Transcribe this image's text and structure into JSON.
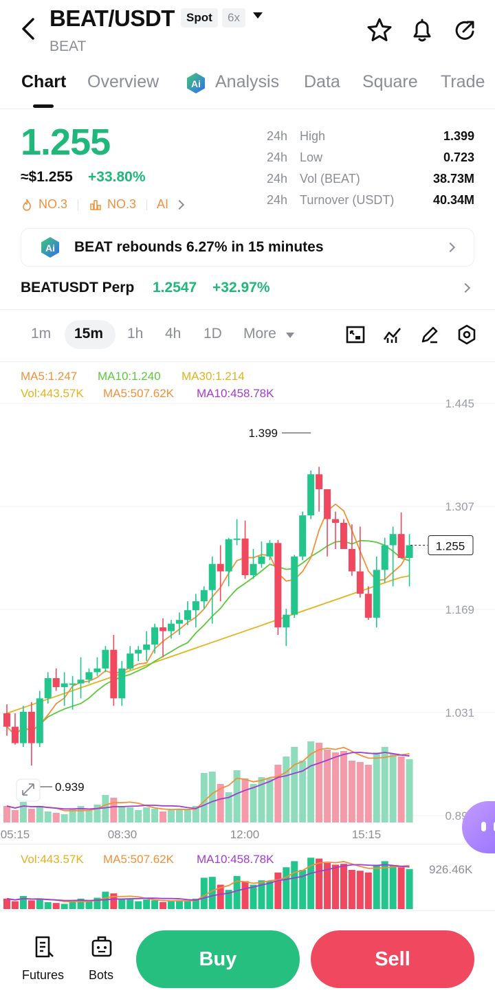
{
  "header": {
    "pair": "BEAT/USDT",
    "market_badge": "Spot",
    "leverage_badge": "6x",
    "subtitle": "BEAT"
  },
  "tabs": [
    {
      "label": "Chart",
      "active": true
    },
    {
      "label": "Overview"
    },
    {
      "label": "Analysis"
    },
    {
      "label": "Data"
    },
    {
      "label": "Square"
    },
    {
      "label": "Trade"
    }
  ],
  "ticker": {
    "last_price": "1.255",
    "usd_price": "≈$1.255",
    "change_pct": "+33.80%",
    "rank_hot": "NO.3",
    "rank_gain": "NO.3",
    "ai_label": "AI",
    "stats": [
      {
        "period": "24h",
        "label": "High",
        "value": "1.399"
      },
      {
        "period": "24h",
        "label": "Low",
        "value": "0.723"
      },
      {
        "period": "24h",
        "label": "Vol (BEAT)",
        "value": "38.73M"
      },
      {
        "period": "24h",
        "label": "Turnover (USDT)",
        "value": "40.34M"
      }
    ]
  },
  "banner": {
    "text": "BEAT rebounds 6.27% in 15 minutes"
  },
  "perp": {
    "name": "BEATUSDT Perp",
    "price": "1.2547",
    "change": "+32.97%"
  },
  "intervals": {
    "items": [
      "1m",
      "15m",
      "1h",
      "4h",
      "1D"
    ],
    "active": "15m",
    "more_label": "More"
  },
  "legend": {
    "ma5": "MA5:1.247",
    "ma10": "MA10:1.240",
    "ma30": "MA30:1.214",
    "vol": "Vol:443.57K",
    "vol_ma5": "MA5:507.62K",
    "vol_ma10": "MA10:458.78K"
  },
  "sub_legend": {
    "vol": "Vol:443.57K",
    "vol_ma5": "MA5:507.62K",
    "vol_ma10": "MA10:458.78K",
    "max": "926.46K"
  },
  "colors": {
    "up": "#1fb77a",
    "down": "#f0495f",
    "ma5": "#f0913a",
    "ma10": "#5ac93a",
    "ma30": "#e3b21d",
    "vol_ma10": "#a23bd1"
  },
  "chart_data": {
    "type": "candlestick",
    "interval": "15m",
    "y_ticks": [
      "1.445",
      "1.307",
      "1.169",
      "1.031",
      "0.893"
    ],
    "ylim": [
      0.893,
      1.445
    ],
    "x_ticks": [
      "05:15",
      "08:30",
      "12:00",
      "15:15"
    ],
    "high_marker": "1.399",
    "low_marker": "0.939",
    "last_price_label": "1.255",
    "candles": [
      [
        1.03,
        1.042,
        1.0,
        1.012
      ],
      [
        1.012,
        1.03,
        0.988,
        0.99
      ],
      [
        0.99,
        1.04,
        0.985,
        1.032
      ],
      [
        1.032,
        1.045,
        0.96,
        0.99
      ],
      [
        0.99,
        1.06,
        0.985,
        1.05
      ],
      [
        1.05,
        1.085,
        1.043,
        1.077
      ],
      [
        1.077,
        1.09,
        1.06,
        1.065
      ],
      [
        1.065,
        1.085,
        1.04,
        1.07
      ],
      [
        1.07,
        1.08,
        1.035,
        1.07
      ],
      [
        1.07,
        1.105,
        1.05,
        1.075
      ],
      [
        1.075,
        1.09,
        1.07,
        1.085
      ],
      [
        1.085,
        1.105,
        1.08,
        1.09
      ],
      [
        1.09,
        1.12,
        1.085,
        1.115
      ],
      [
        1.115,
        1.135,
        1.04,
        1.05
      ],
      [
        1.05,
        1.1,
        1.04,
        1.09
      ],
      [
        1.09,
        1.12,
        1.088,
        1.11
      ],
      [
        1.11,
        1.12,
        1.1,
        1.115
      ],
      [
        1.115,
        1.14,
        1.1,
        1.122
      ],
      [
        1.122,
        1.15,
        1.11,
        1.145
      ],
      [
        1.145,
        1.157,
        1.105,
        1.14
      ],
      [
        1.14,
        1.155,
        1.13,
        1.15
      ],
      [
        1.15,
        1.165,
        1.135,
        1.155
      ],
      [
        1.155,
        1.18,
        1.148,
        1.168
      ],
      [
        1.168,
        1.19,
        1.145,
        1.18
      ],
      [
        1.18,
        1.2,
        1.17,
        1.195
      ],
      [
        1.195,
        1.24,
        1.15,
        1.23
      ],
      [
        1.23,
        1.255,
        1.18,
        1.22
      ],
      [
        1.22,
        1.265,
        1.2,
        1.263
      ],
      [
        1.263,
        1.29,
        1.255,
        1.264
      ],
      [
        1.264,
        1.288,
        1.21,
        1.215
      ],
      [
        1.215,
        1.25,
        1.21,
        1.23
      ],
      [
        1.23,
        1.26,
        1.225,
        1.24
      ],
      [
        1.24,
        1.262,
        1.235,
        1.258
      ],
      [
        1.258,
        1.262,
        1.135,
        1.145
      ],
      [
        1.145,
        1.17,
        1.12,
        1.162
      ],
      [
        1.162,
        1.242,
        1.158,
        1.24
      ],
      [
        1.24,
        1.3,
        1.235,
        1.295
      ],
      [
        1.295,
        1.355,
        1.29,
        1.35
      ],
      [
        1.35,
        1.36,
        1.3,
        1.33
      ],
      [
        1.33,
        1.33,
        1.24,
        1.29
      ],
      [
        1.29,
        1.3,
        1.25,
        1.285
      ],
      [
        1.285,
        1.29,
        1.275,
        1.25
      ],
      [
        1.25,
        1.283,
        1.214,
        1.22
      ],
      [
        1.22,
        1.28,
        1.185,
        1.19
      ],
      [
        1.19,
        1.2,
        1.155,
        1.158
      ],
      [
        1.158,
        1.24,
        1.145,
        1.222
      ],
      [
        1.222,
        1.265,
        1.205,
        1.255
      ],
      [
        1.255,
        1.28,
        1.2,
        1.27
      ],
      [
        1.27,
        1.299,
        1.24,
        1.238
      ],
      [
        1.238,
        1.27,
        1.2,
        1.255
      ]
    ],
    "volumes": [
      0.12,
      0.09,
      0.15,
      0.1,
      0.12,
      0.08,
      0.07,
      0.06,
      0.1,
      0.12,
      0.09,
      0.13,
      0.2,
      0.18,
      0.12,
      0.11,
      0.09,
      0.11,
      0.1,
      0.08,
      0.09,
      0.1,
      0.1,
      0.12,
      0.36,
      0.37,
      0.28,
      0.22,
      0.38,
      0.32,
      0.28,
      0.33,
      0.32,
      0.42,
      0.48,
      0.55,
      0.45,
      0.59,
      0.58,
      0.53,
      0.51,
      0.52,
      0.45,
      0.44,
      0.42,
      0.51,
      0.55,
      0.5,
      0.48,
      0.46
    ]
  }
}
